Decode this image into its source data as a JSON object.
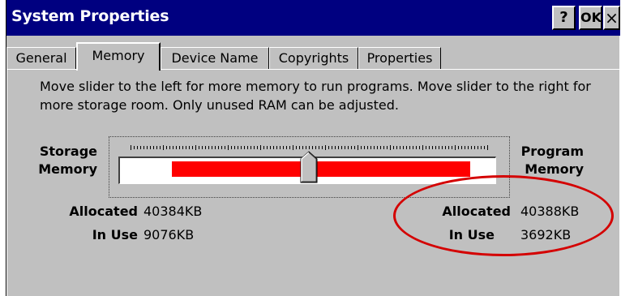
{
  "window": {
    "title": "System Properties",
    "buttons": {
      "help": "?",
      "ok": "OK",
      "close": "×"
    }
  },
  "tabs": [
    {
      "label": "General",
      "active": false
    },
    {
      "label": "Memory",
      "active": true
    },
    {
      "label": "Device Name",
      "active": false
    },
    {
      "label": "Copyrights",
      "active": false
    },
    {
      "label": "Properties",
      "active": false
    }
  ],
  "memory": {
    "description": "Move slider to the left for more memory to run programs. Move slider to the right for more storage room. Only unused RAM can be adjusted.",
    "slider": {
      "left_label": "Storage\nMemory",
      "right_label": "Program\nMemory",
      "position_fraction": 0.5
    },
    "storage": {
      "allocated_label": "Allocated",
      "allocated_value": "40384KB",
      "in_use_label": "In Use",
      "in_use_value": "9076KB"
    },
    "program": {
      "allocated_label": "Allocated",
      "allocated_value": "40388KB",
      "in_use_label": "In Use",
      "in_use_value": "3692KB"
    }
  },
  "colors": {
    "titlebar": "#000080",
    "face": "#c0c0c0",
    "slider_fill": "#ff0000",
    "annotation": "#d40000"
  }
}
